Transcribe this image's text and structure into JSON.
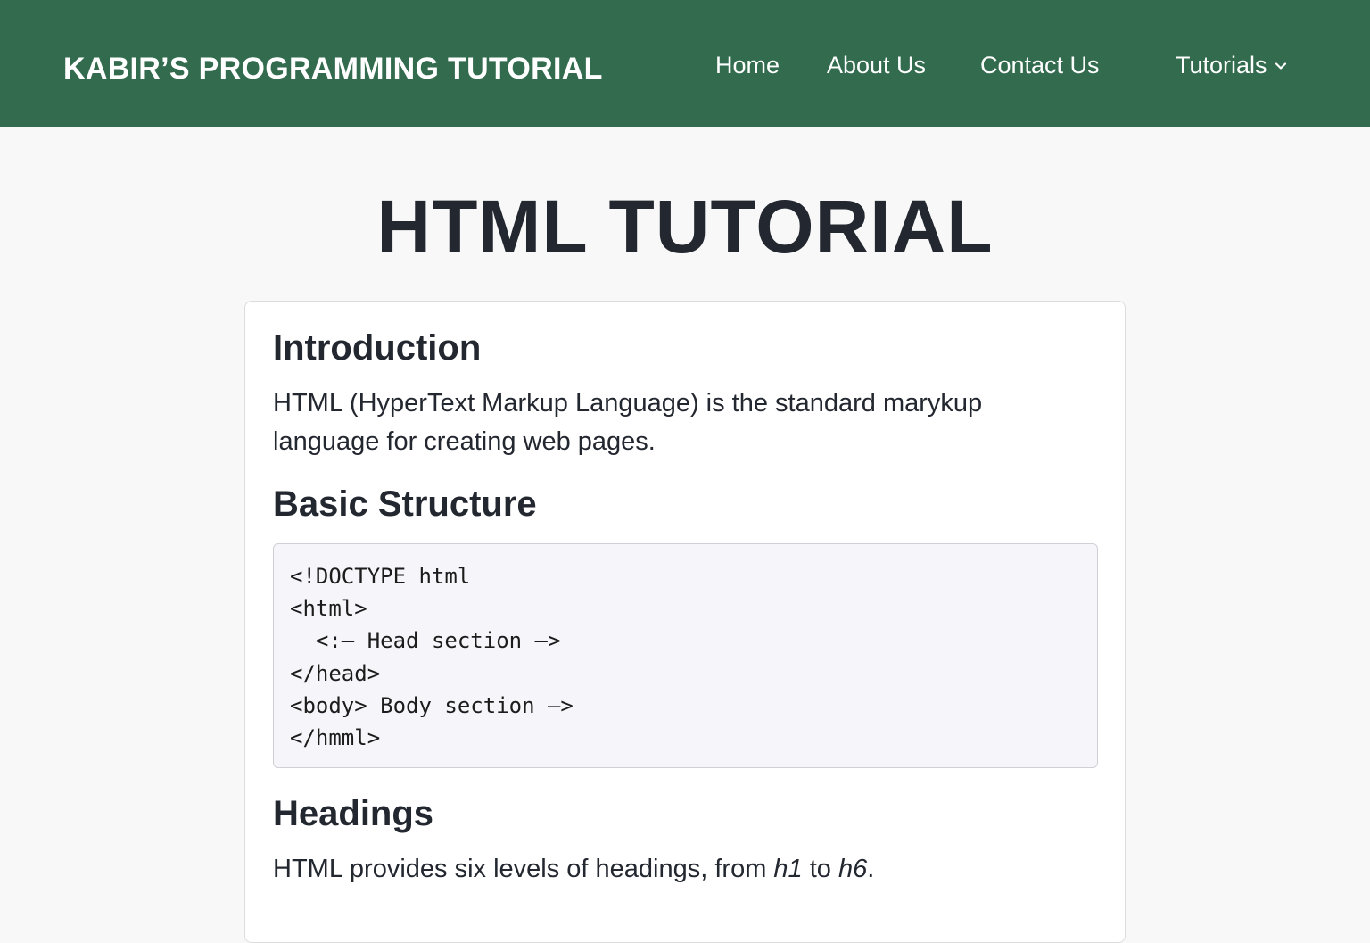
{
  "navbar": {
    "brand": "KABIR’S PROGRAMMING TUTORIAL",
    "links": [
      {
        "label": "Home"
      },
      {
        "label": "About Us"
      },
      {
        "label": "Contact Us"
      },
      {
        "label": "Tutorials",
        "icon": "chevron-down-icon"
      }
    ],
    "background_color": "#326b4d"
  },
  "page": {
    "title": "HTML TUTORIAL"
  },
  "content": {
    "introduction": {
      "heading": "Introduction",
      "text": "HTML (HyperText Markup Language) is the standard marykup language for creating web pages."
    },
    "basic_structure": {
      "heading": "Basic Structure",
      "code_lines": [
        "<!DOCTYPE html",
        "<html>",
        "  <:– Head section –>",
        "</head>",
        "<body> Body section –>",
        "</hmml>"
      ]
    },
    "headings": {
      "heading": "Headings",
      "text_before": "HTML provides six levels of headings, from ",
      "h1": "h1",
      "text_middle": " to ",
      "h6": "h6",
      "text_after": "."
    }
  }
}
